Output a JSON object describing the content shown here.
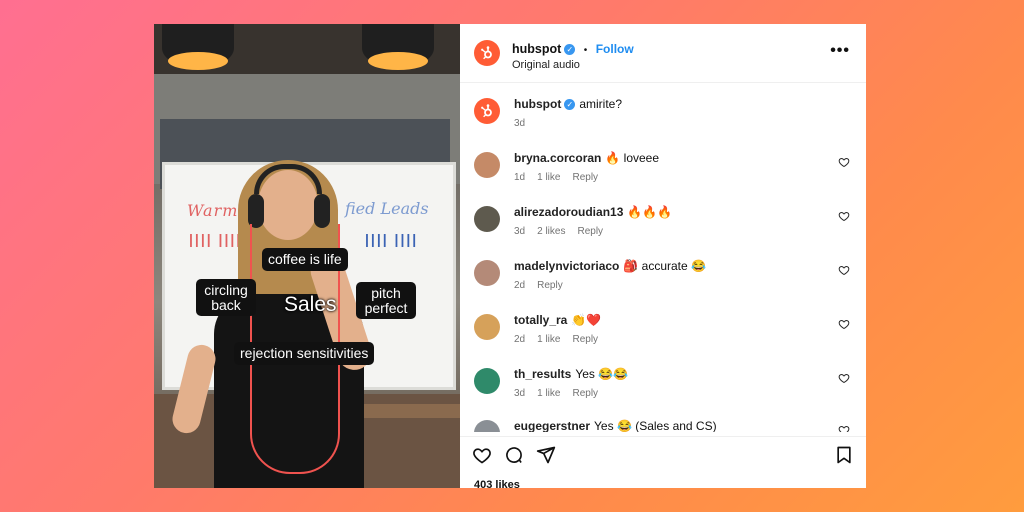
{
  "post": {
    "account": "hubspot",
    "follow_label": "Follow",
    "separator": "•",
    "audio": "Original audio",
    "more": "•••",
    "caption_user": "hubspot",
    "caption_text": "amirite?",
    "caption_age": "3d"
  },
  "video": {
    "captions": {
      "coffee": "coffee is life",
      "circling": "circling back",
      "sales": "Sales",
      "pitch": "pitch perfect",
      "rejection": "rejection sensitivities"
    },
    "board_left": "Warm C",
    "board_right": "fied Leads",
    "tally": "|||| ||||"
  },
  "comments": [
    {
      "user": "bryna.corcoran",
      "text": "🔥 loveee",
      "age": "1d",
      "likes": "1 like",
      "reply": "Reply",
      "avatar_color": "#c58a67"
    },
    {
      "user": "alirezadoroudian13",
      "text": "🔥🔥🔥",
      "age": "3d",
      "likes": "2 likes",
      "reply": "Reply",
      "avatar_color": "#5e5a4e"
    },
    {
      "user": "madelynvictoriaco",
      "text": "🎒 accurate 😂",
      "age": "2d",
      "likes": "",
      "reply": "Reply",
      "avatar_color": "#b48a78"
    },
    {
      "user": "totally_ra",
      "text": "👏❤️",
      "age": "2d",
      "likes": "1 like",
      "reply": "Reply",
      "avatar_color": "#d6a15a"
    },
    {
      "user": "th_results",
      "text": "Yes 😂😂",
      "age": "3d",
      "likes": "1 like",
      "reply": "Reply",
      "avatar_color": "#2f8a6a"
    },
    {
      "user": "eugegerstner",
      "text": "Yes 😂 (Sales and CS)",
      "age": "",
      "likes": "",
      "reply": "",
      "avatar_color": "#8a8f95"
    }
  ],
  "footer": {
    "likes": "403 likes"
  },
  "colors": {
    "brand": "#ff5c35",
    "follow": "#1e8cf0",
    "verified": "#3897f0"
  }
}
